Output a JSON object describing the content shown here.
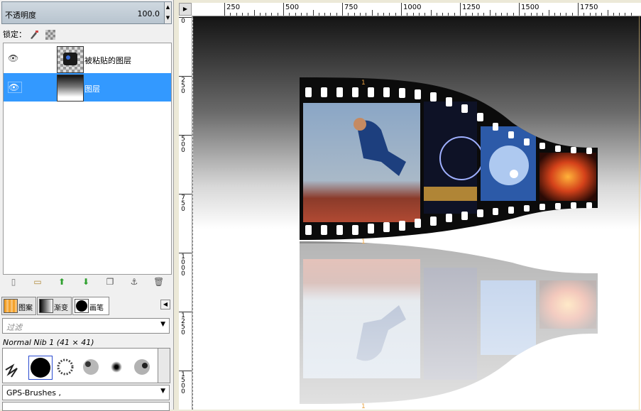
{
  "layers_panel": {
    "opacity_label": "不透明度",
    "opacity_value": "100.0",
    "lock_label": "锁定："
  },
  "layers": [
    {
      "name": "被粘贴的图层",
      "selected": false
    },
    {
      "name": "图层",
      "selected": true
    }
  ],
  "tabs": [
    {
      "label": "图案"
    },
    {
      "label": "渐变"
    },
    {
      "label": "画笔"
    }
  ],
  "brushes": {
    "filter_placeholder": "过滤",
    "current_brush": "Normal Nib 1 (41 × 41)",
    "tag_value": "GPS-Brushes ,"
  },
  "rulers": {
    "top_labels": [
      "250",
      "500",
      "750",
      "1000",
      "1250",
      "1500",
      "1750"
    ],
    "left_labels": [
      "0",
      "250",
      "500",
      "750",
      "1000",
      "1250",
      "1500"
    ]
  },
  "colors": {
    "selection": "#3399ff",
    "filmstrip": "#0b0b0b",
    "accent": "#e8c77a"
  },
  "icons": {
    "visibility": "eye-icon",
    "new_layer": "new-layer-icon",
    "folder": "layer-group-icon",
    "raise": "raise-layer-icon",
    "lower": "lower-layer-icon",
    "duplicate": "duplicate-layer-icon",
    "anchor": "anchor-icon",
    "delete": "trash-icon"
  }
}
